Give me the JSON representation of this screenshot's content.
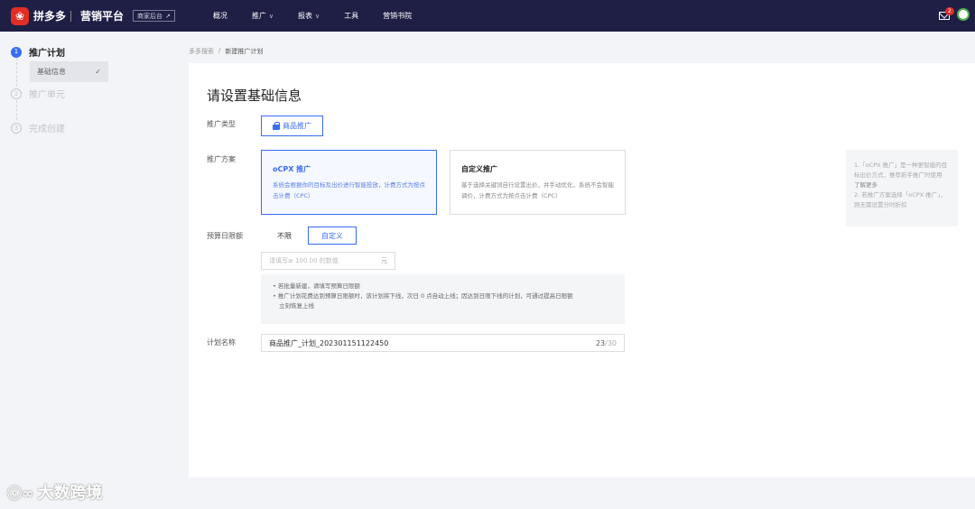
{
  "topbar": {
    "logo_text": "拼多多",
    "platform": "营销平台",
    "backend_link": "商家后台",
    "nav": [
      {
        "label": "概况",
        "has_dropdown": false
      },
      {
        "label": "推广",
        "has_dropdown": true
      },
      {
        "label": "报表",
        "has_dropdown": true
      },
      {
        "label": "工具",
        "has_dropdown": false
      },
      {
        "label": "营销书院",
        "has_dropdown": false
      }
    ],
    "mail_badge": "2"
  },
  "sidebar": {
    "steps": [
      {
        "num": "1",
        "label": "推广计划",
        "state": "active"
      },
      {
        "num": "2",
        "label": "推广单元",
        "state": "inactive"
      },
      {
        "num": "3",
        "label": "完成创建",
        "state": "inactive"
      }
    ],
    "substep": {
      "label": "基础信息",
      "check": "✓"
    }
  },
  "breadcrumb": [
    "多多搜索",
    "/",
    "新建推广计划"
  ],
  "form": {
    "title": "请设置基础信息",
    "labels": {
      "type": "推广类型",
      "plan": "推广方案",
      "budget": "预算日限额",
      "name": "计划名称"
    },
    "type_button": "商品推广",
    "plans": [
      {
        "title": "oCPX 推广",
        "desc": "系统会根据你的目标及出价进行智能投放，计费方式为按点击计费（CPC）",
        "selected": true
      },
      {
        "title": "自定义推广",
        "desc": "基于选择关键词自行设置出价，并手动优化，系统不会智能调价，计费方式为按点击计费（CPC）",
        "selected": false
      }
    ],
    "budget_options": [
      "不限",
      "自定义"
    ],
    "budget_selected": "自定义",
    "amount_placeholder": "请填写≥ 100.00 的数值",
    "amount_unit": "元",
    "tips": [
      "• 若批量新建，请填写预算日限额",
      "• 推广计划花费达到预算日限额时，该计划将下线，次日 0 点自动上线；因达到日限下线的计划，可通过提高日限额",
      "立刻恢复上线"
    ],
    "plan_name_value": "商品推广_计划_202301151122450",
    "plan_name_count": "23",
    "plan_name_max": "/30"
  },
  "hint": {
    "line1": "1.「oCPX 推广」是一种更智能的目标出价方式，推荐新手推广时使用",
    "link": "了解更多",
    "line2": "2. 若推广方案选择「oCPX 推广」，则无需设置分时折扣"
  },
  "watermark": {
    "text": "大数跨境",
    "logo": "ⓒ∞"
  }
}
